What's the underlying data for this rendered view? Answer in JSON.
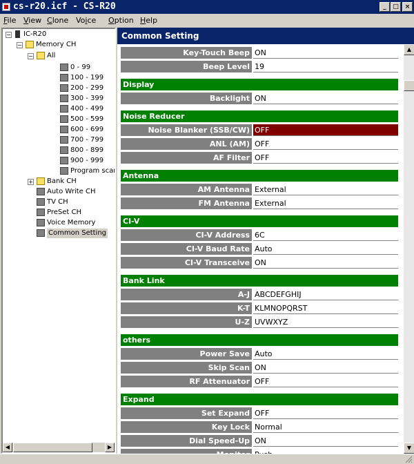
{
  "window": {
    "title": "cs-r20.icf - CS-R20"
  },
  "titlebar_buttons": {
    "minimize": "_",
    "maximize": "□",
    "close": "×"
  },
  "menu": [
    {
      "label": "File",
      "u": "F",
      "rest": "ile"
    },
    {
      "label": "View",
      "u": "V",
      "rest": "iew"
    },
    {
      "label": "Clone",
      "u": "C",
      "rest": "lone"
    },
    {
      "label": "Voice",
      "u": "",
      "pre": "Vo",
      "mid": "i",
      "post": "ce"
    },
    {
      "label": "Option",
      "u": "O",
      "rest": "ption"
    },
    {
      "label": "Help",
      "u": "H",
      "rest": "elp"
    }
  ],
  "tree": {
    "root": "IC-R20",
    "memory_ch": "Memory CH",
    "all": "All",
    "channels": [
      "0 - 99",
      "100 - 199",
      "200 - 299",
      "300 - 399",
      "400 - 499",
      "500 - 599",
      "600 - 699",
      "700 - 799",
      "800 - 899",
      "900 - 999",
      "Program scan"
    ],
    "bank_ch": "Bank CH",
    "others": [
      "Auto Write CH",
      "TV CH",
      "PreSet CH",
      "Voice Memory",
      "Common Setting"
    ]
  },
  "panel": {
    "header": "Common Setting"
  },
  "sections": [
    {
      "title": "",
      "rows": [
        {
          "label": "Key-Touch Beep",
          "value": "ON"
        },
        {
          "label": "Beep Level",
          "value": "19"
        }
      ]
    },
    {
      "title": "Display",
      "rows": [
        {
          "label": "Backlight",
          "value": "ON"
        }
      ]
    },
    {
      "title": "Noise Reducer",
      "rows": [
        {
          "label": "Noise Blanker (SSB/CW)",
          "value": "OFF",
          "selected": true
        },
        {
          "label": "ANL (AM)",
          "value": "OFF"
        },
        {
          "label": "AF Filter",
          "value": "OFF"
        }
      ]
    },
    {
      "title": "Antenna",
      "rows": [
        {
          "label": "AM Antenna",
          "value": "External"
        },
        {
          "label": "FM Antenna",
          "value": "External"
        }
      ]
    },
    {
      "title": "CI-V",
      "rows": [
        {
          "label": "CI-V Address",
          "value": "6C"
        },
        {
          "label": "CI-V Baud Rate",
          "value": "Auto"
        },
        {
          "label": "CI-V Transceive",
          "value": "ON"
        }
      ]
    },
    {
      "title": "Bank Link",
      "rows": [
        {
          "label": "A-J",
          "value": "ABCDEFGHIJ"
        },
        {
          "label": "K-T",
          "value": "KLMNOPQRST"
        },
        {
          "label": "U-Z",
          "value": "UVWXYZ"
        }
      ]
    },
    {
      "title": "others",
      "rows": [
        {
          "label": "Power Save",
          "value": "Auto"
        },
        {
          "label": "Skip Scan",
          "value": "ON"
        },
        {
          "label": "RF Attenuator",
          "value": "OFF"
        }
      ]
    },
    {
      "title": "Expand",
      "rows": [
        {
          "label": "Set Expand",
          "value": "OFF"
        },
        {
          "label": "Key Lock",
          "value": "Normal"
        },
        {
          "label": "Dial Speed-Up",
          "value": "ON"
        },
        {
          "label": "Monitor",
          "value": "Push"
        }
      ]
    }
  ]
}
